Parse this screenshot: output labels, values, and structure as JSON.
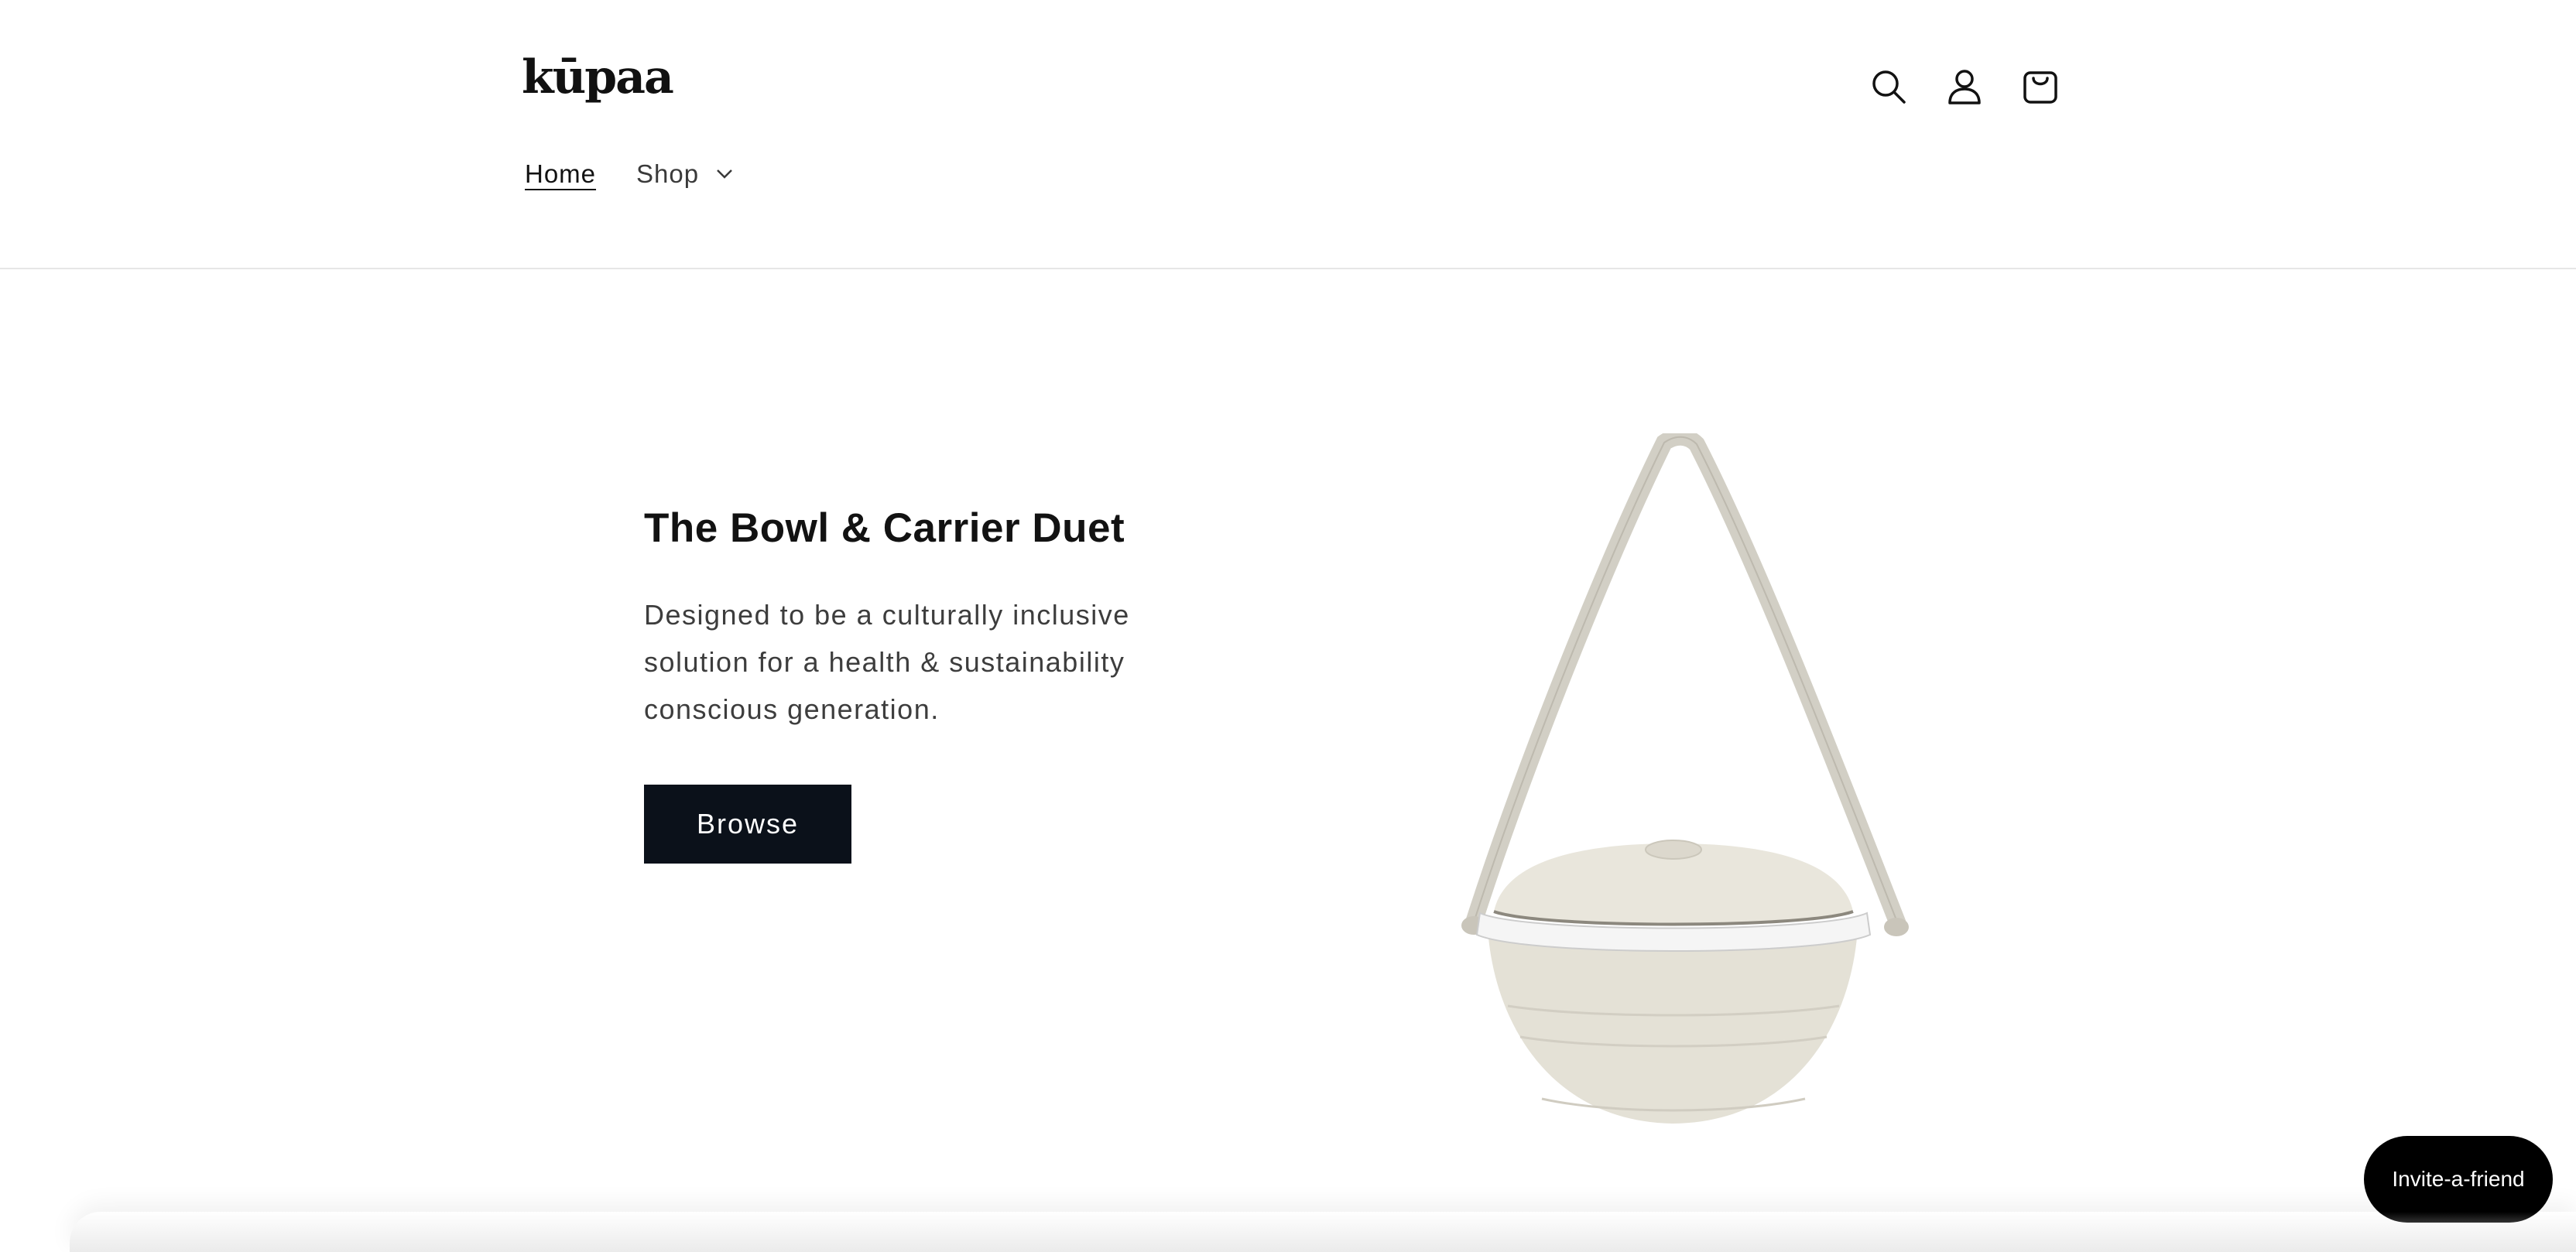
{
  "header": {
    "logo_text": "kūpaa",
    "nav": [
      {
        "label": "Home",
        "active": true
      },
      {
        "label": "Shop",
        "has_dropdown": true
      }
    ],
    "icons": [
      "search-icon",
      "account-icon",
      "cart-icon"
    ]
  },
  "hero": {
    "title": "The Bowl & Carrier Duet",
    "description": "Designed to be a culturally inclusive solution for a health & sustainability conscious generation.",
    "button_label": "Browse"
  },
  "invite": {
    "label": "Invite-a-friend"
  },
  "colors": {
    "button_bg": "#0b111a",
    "product_body": "#e4e1d6",
    "invite_bg": "#000000"
  }
}
